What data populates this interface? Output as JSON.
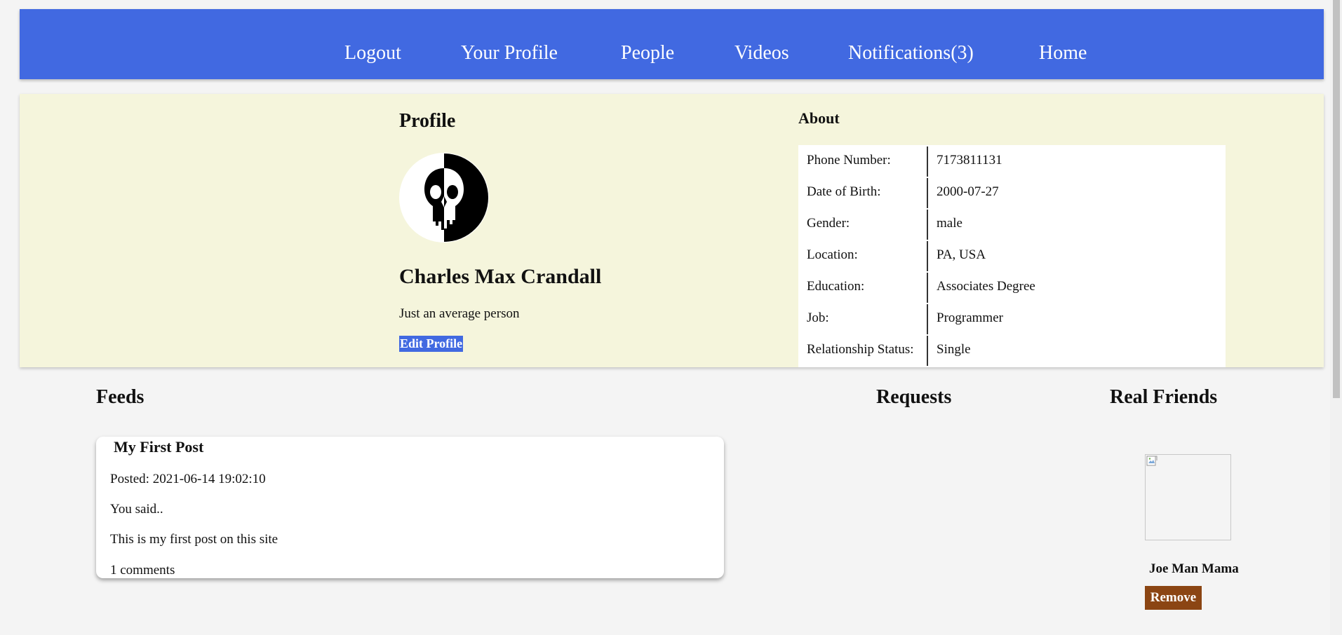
{
  "nav": {
    "items": [
      {
        "label": "Logout"
      },
      {
        "label": "Your Profile"
      },
      {
        "label": "People"
      },
      {
        "label": "Videos"
      },
      {
        "label": "Notifications(3)"
      },
      {
        "label": "Home"
      }
    ],
    "background": "#4169e1"
  },
  "profile": {
    "heading": "Profile",
    "avatar_icon": "skull-icon",
    "name": "Charles Max Crandall",
    "bio": "Just an average person",
    "edit_label": "Edit Profile"
  },
  "about": {
    "heading": "About",
    "rows": [
      {
        "label": "Phone Number:",
        "value": "7173811131"
      },
      {
        "label": "Date of Birth:",
        "value": "2000-07-27"
      },
      {
        "label": "Gender:",
        "value": "male"
      },
      {
        "label": "Location:",
        "value": "PA, USA"
      },
      {
        "label": "Education:",
        "value": "Associates Degree"
      },
      {
        "label": "Job:",
        "value": "Programmer"
      },
      {
        "label": "Relationship Status:",
        "value": "Single"
      }
    ]
  },
  "feeds": {
    "heading": "Feeds",
    "posts": [
      {
        "title": "My First Post",
        "posted": "Posted: 2021-06-14 19:02:10",
        "intro": "You said..",
        "body": "This is my first post on this site",
        "comments": "1 comments"
      }
    ]
  },
  "requests": {
    "heading": "Requests"
  },
  "friends": {
    "heading": "Real Friends",
    "items": [
      {
        "name": "Joe Man Mama",
        "remove_label": "Remove",
        "photo_icon": "broken-image-icon"
      }
    ]
  },
  "colors": {
    "page_bg": "#f4f4f4",
    "profile_bg": "#f5f5dc",
    "remove_button": "#8b4513"
  }
}
